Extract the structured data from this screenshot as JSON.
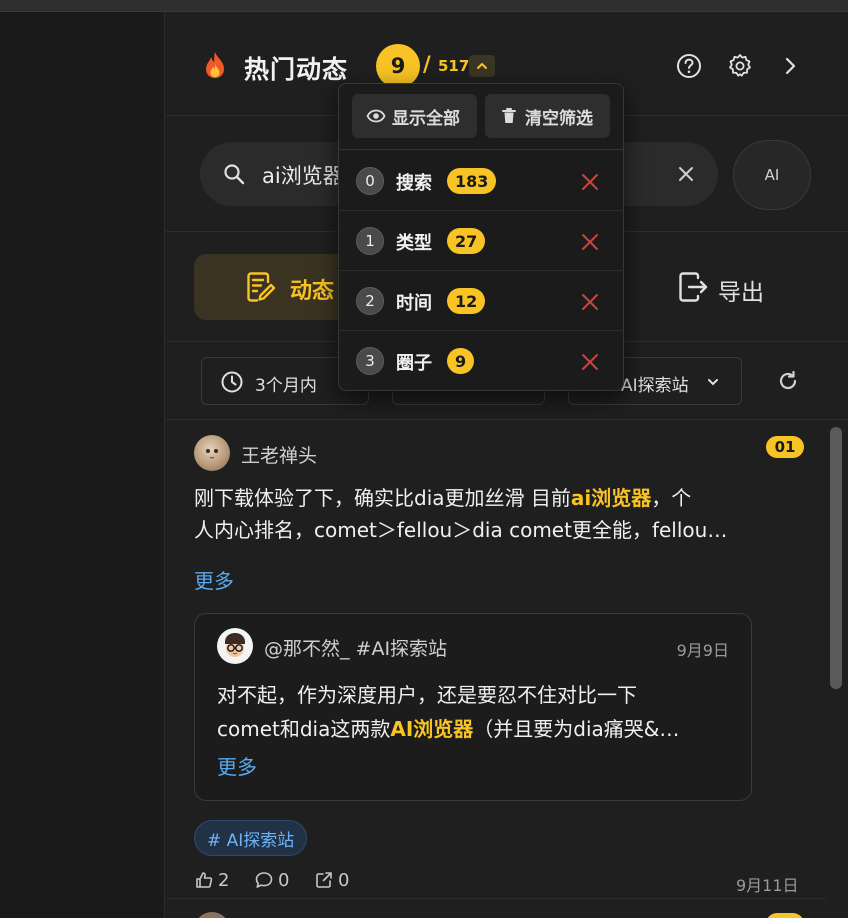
{
  "header": {
    "title": "热门动态",
    "count": "9",
    "slash": "/",
    "total": "517"
  },
  "search": {
    "query": "ai浏览器",
    "ai_label": "AI"
  },
  "tabs": {
    "active_label": "动态",
    "export_label": "导出"
  },
  "filters": {
    "time": "3个月内",
    "circle": "AI探索站"
  },
  "post": {
    "author": "王老禅头",
    "rank": "01",
    "text_line1_pre": "刚下载体验了下，确实比dia更加丝滑 目前",
    "text_line1_hl": "ai浏览器",
    "text_line1_post": "，个",
    "text_line2": "人内心排名，comet＞fellou＞dia comet更全能，fellou…",
    "more": "更多",
    "quote": {
      "author": "@那不然_  #AI探索站",
      "date": "9月9日",
      "line1": "对不起，作为深度用户，还是要忍不住对比一下",
      "line2_pre": "comet和dia这两款",
      "line2_hl": "AI浏览器",
      "line2_post": "（并且要为dia痛哭&…",
      "more": "更多"
    },
    "tag": "# AI探索站",
    "likes": "2",
    "comments": "0",
    "shares": "0",
    "date": "9月11日"
  },
  "dropdown": {
    "show_all": "显示全部",
    "clear_filters": "清空筛选",
    "items": [
      {
        "index": "0",
        "label": "搜索",
        "count": "183"
      },
      {
        "index": "1",
        "label": "类型",
        "count": "27"
      },
      {
        "index": "2",
        "label": "时间",
        "count": "12"
      },
      {
        "index": "3",
        "label": "圈子",
        "count": "9"
      }
    ]
  },
  "colors": {
    "accent": "#f7c325",
    "link": "#5aa9f0",
    "danger": "#c9443f"
  }
}
